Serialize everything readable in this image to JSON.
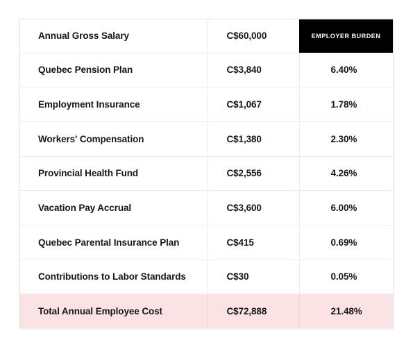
{
  "table": {
    "rows": [
      {
        "label": "Annual Gross Salary",
        "amount": "C$60,000",
        "percent": "EMPLOYER BURDEN",
        "kind": "header"
      },
      {
        "label": "Quebec Pension Plan",
        "amount": "C$3,840",
        "percent": "6.40%",
        "kind": "data"
      },
      {
        "label": "Employment Insurance",
        "amount": "C$1,067",
        "percent": "1.78%",
        "kind": "data"
      },
      {
        "label": "Workers' Compensation",
        "amount": "C$1,380",
        "percent": "2.30%",
        "kind": "data"
      },
      {
        "label": "Provincial Health Fund",
        "amount": "C$2,556",
        "percent": "4.26%",
        "kind": "data"
      },
      {
        "label": "Vacation Pay Accrual",
        "amount": "C$3,600",
        "percent": "6.00%",
        "kind": "data"
      },
      {
        "label": "Quebec Parental Insurance Plan",
        "amount": "C$415",
        "percent": "0.69%",
        "kind": "data"
      },
      {
        "label": "Contributions to Labor Standards",
        "amount": "C$30",
        "percent": "0.05%",
        "kind": "data"
      },
      {
        "label": "Total Annual Employee Cost",
        "amount": "C$72,888",
        "percent": "21.48%",
        "kind": "total"
      }
    ]
  },
  "colors": {
    "header_background": "#000000",
    "header_text": "#ffffff",
    "total_background": "#fbe3e5",
    "text": "#15161a",
    "divider": "#ededed",
    "card_border": "#e8e8e8",
    "page_background": "#ffffff"
  }
}
